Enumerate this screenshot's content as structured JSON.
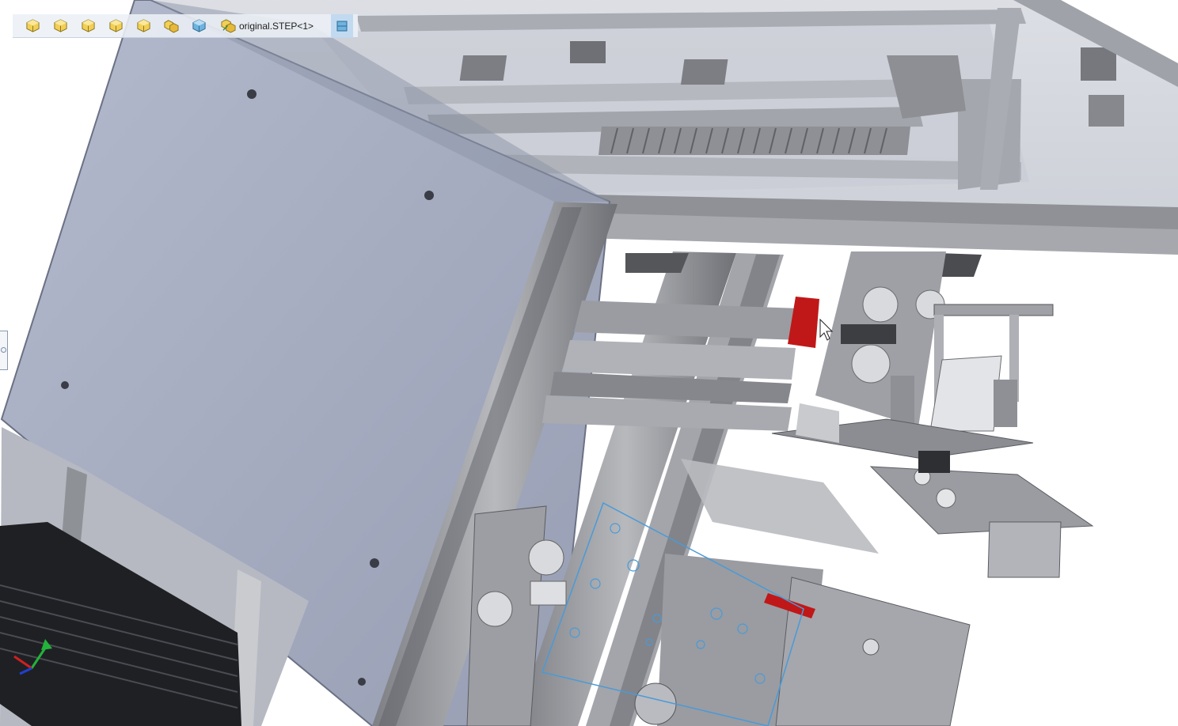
{
  "breadcrumb": {
    "items": [
      {
        "icon": "part-yellow-cube-icon"
      },
      {
        "icon": "part-yellow-cube-icon"
      },
      {
        "icon": "part-yellow-cube-icon"
      },
      {
        "icon": "part-yellow-cube-icon"
      },
      {
        "icon": "part-yellow-cube-icon"
      },
      {
        "icon": "assembly-stack-icon"
      },
      {
        "icon": "part-blue-cube-icon"
      }
    ],
    "file_label": "original.STEP<1>",
    "file_icon": "assembly-icon",
    "end_icon": "body-icon"
  },
  "colors": {
    "panel": "#a7aec2",
    "frame": "#9a9ca0",
    "bracket": "#8c8c90",
    "accent_red": "#c01818",
    "selection": "#4a9ad8"
  }
}
